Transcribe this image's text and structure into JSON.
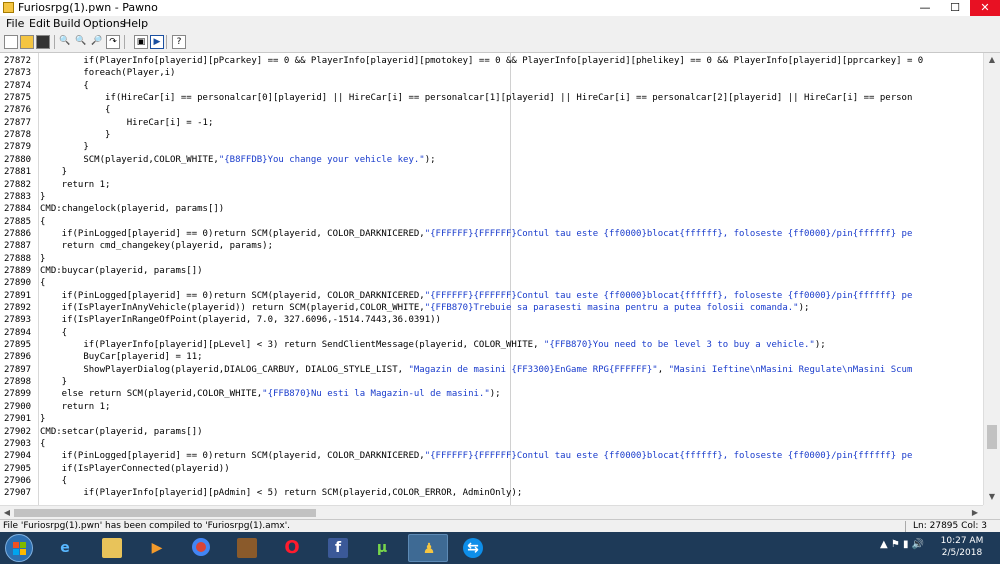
{
  "window": {
    "title": "Furiosrpg(1).pwn - Pawno",
    "minimize": "—",
    "maximize": "☐",
    "close": "✕"
  },
  "menu": [
    "File",
    "Edit",
    "Build",
    "Options",
    "Help"
  ],
  "toolbar": {
    "buttons": [
      "new-icon",
      "open-icon",
      "save-icon",
      "find-icon",
      "find-next-icon",
      "replace-icon",
      "goto-line-icon",
      "compile-icon",
      "run-icon",
      "help-icon"
    ]
  },
  "editor": {
    "lines": [
      {
        "n": "27872",
        "t": "        if(PlayerInfo[playerid][pPcarkey] == 0 && PlayerInfo[playerid][pmotokey] == 0 && PlayerInfo[playerid][phelikey] == 0 && PlayerInfo[playerid][pprcarkey] = 0"
      },
      {
        "n": "27873",
        "t": "        foreach(Player,i)"
      },
      {
        "n": "27874",
        "t": "        {"
      },
      {
        "n": "27875",
        "t": "            if(HireCar[i] == personalcar[0][playerid] || HireCar[i] == personalcar[1][playerid] || HireCar[i] == personalcar[2][playerid] || HireCar[i] == person"
      },
      {
        "n": "27876",
        "t": "            {"
      },
      {
        "n": "27877",
        "t": "                HireCar[i] = -1;"
      },
      {
        "n": "27878",
        "t": "            }"
      },
      {
        "n": "27879",
        "t": "        }"
      },
      {
        "n": "27880",
        "t": "        SCM(playerid,COLOR_WHITE,\"{B8FFDB}You change your vehicle key.\");"
      },
      {
        "n": "27881",
        "t": "    }"
      },
      {
        "n": "27882",
        "t": "    return 1;"
      },
      {
        "n": "27883",
        "t": "}"
      },
      {
        "n": "27884",
        "t": "CMD:changelock(playerid, params[])"
      },
      {
        "n": "27885",
        "t": "{"
      },
      {
        "n": "27886",
        "t": "    if(PinLogged[playerid] == 0)return SCM(playerid, COLOR_DARKNICERED,\"{FFFFFF}{FFFFFF}Contul tau este {ff0000}blocat{ffffff}, foloseste {ff0000}/pin{ffffff} pe"
      },
      {
        "n": "27887",
        "t": "    return cmd_changekey(playerid, params);"
      },
      {
        "n": "27888",
        "t": "}"
      },
      {
        "n": "27889",
        "t": "CMD:buycar(playerid, params[])"
      },
      {
        "n": "27890",
        "t": "{"
      },
      {
        "n": "27891",
        "t": "    if(PinLogged[playerid] == 0)return SCM(playerid, COLOR_DARKNICERED,\"{FFFFFF}{FFFFFF}Contul tau este {ff0000}blocat{ffffff}, foloseste {ff0000}/pin{ffffff} pe"
      },
      {
        "n": "27892",
        "t": "    if(IsPlayerInAnyVehicle(playerid)) return SCM(playerid,COLOR_WHITE,\"{FFB870}Trebuie sa parasesti masina pentru a putea folosii comanda.\");"
      },
      {
        "n": "27893",
        "t": "    if(IsPlayerInRangeOfPoint(playerid, 7.0, 327.6096,-1514.7443,36.0391))"
      },
      {
        "n": "27894",
        "t": "    {"
      },
      {
        "n": "27895",
        "t": "        if(PlayerInfo[playerid][pLevel] < 3) return SendClientMessage(playerid, COLOR_WHITE, \"{FFB870}You need to be level 3 to buy a vehicle.\");"
      },
      {
        "n": "27896",
        "t": "        BuyCar[playerid] = 11;"
      },
      {
        "n": "27897",
        "t": "        ShowPlayerDialog(playerid,DIALOG_CARBUY, DIALOG_STYLE_LIST, \"Magazin de masini {FF3300}EnGame RPG{FFFFFF}\", \"Masini Ieftine\\nMasini Regulate\\nMasini Scum"
      },
      {
        "n": "27898",
        "t": "    }"
      },
      {
        "n": "27899",
        "t": "    else return SCM(playerid,COLOR_WHITE,\"{FFB870}Nu esti la Magazin-ul de masini.\");"
      },
      {
        "n": "27900",
        "t": "    return 1;"
      },
      {
        "n": "27901",
        "t": "}"
      },
      {
        "n": "27902",
        "t": "CMD:setcar(playerid, params[])"
      },
      {
        "n": "27903",
        "t": "{"
      },
      {
        "n": "27904",
        "t": "    if(PinLogged[playerid] == 0)return SCM(playerid, COLOR_DARKNICERED,\"{FFFFFF}{FFFFFF}Contul tau este {ff0000}blocat{ffffff}, foloseste {ff0000}/pin{ffffff} pe"
      },
      {
        "n": "27905",
        "t": "    if(IsPlayerConnected(playerid))"
      },
      {
        "n": "27906",
        "t": "    {"
      },
      {
        "n": "27907",
        "t": "        if(PlayerInfo[playerid][pAdmin] < 5) return SCM(playerid,COLOR_ERROR, AdminOnly);"
      }
    ]
  },
  "status": {
    "message": "File 'Furiosrpg(1).pwn' has been compiled to 'Furiosrpg(1).amx'.",
    "position": "Ln: 27895   Col: 3"
  },
  "taskbar": {
    "apps": [
      "internet-explorer-icon",
      "file-explorer-icon",
      "media-player-icon",
      "chrome-icon",
      "game-icon",
      "opera-icon",
      "facebook-icon",
      "utorrent-icon",
      "pawno-icon",
      "teamviewer-icon"
    ],
    "clock_time": "10:27 AM",
    "clock_date": "2/5/2018"
  },
  "colors": {
    "string": "#1a3ccc",
    "taskbar": "#1e3a58",
    "close": "#e81123"
  }
}
